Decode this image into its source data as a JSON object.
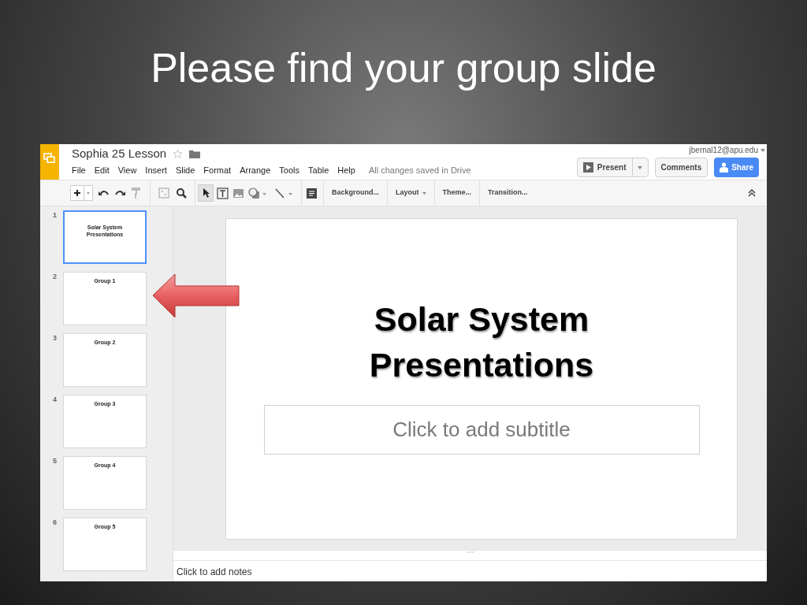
{
  "slide_title": "Please find your group slide",
  "app": {
    "doc_title": "Sophia 25 Lesson",
    "account": "jbernal12@apu.edu",
    "menus": [
      "File",
      "Edit",
      "View",
      "Insert",
      "Slide",
      "Format",
      "Arrange",
      "Tools",
      "Table",
      "Help"
    ],
    "save_status": "All changes saved in Drive",
    "present_button": "Present",
    "comments_button": "Comments",
    "share_button": "Share",
    "toolbar_buttons": [
      {
        "label": "Background...",
        "dropdown": false
      },
      {
        "label": "Layout",
        "dropdown": true
      },
      {
        "label": "Theme...",
        "dropdown": false
      },
      {
        "label": "Transition...",
        "dropdown": false
      }
    ],
    "filmstrip": [
      {
        "number": "1",
        "title_lines": [
          "Solar System",
          "Presentations"
        ],
        "selected": true
      },
      {
        "number": "2",
        "title_lines": [
          "Group 1"
        ],
        "selected": false
      },
      {
        "number": "3",
        "title_lines": [
          "Group 2"
        ],
        "selected": false
      },
      {
        "number": "4",
        "title_lines": [
          "Group 3"
        ],
        "selected": false
      },
      {
        "number": "5",
        "title_lines": [
          "Group 4"
        ],
        "selected": false
      },
      {
        "number": "6",
        "title_lines": [
          "Group 5"
        ],
        "selected": false
      }
    ],
    "current_slide": {
      "title_lines": [
        "Solar System",
        "Presentations"
      ],
      "subtitle_placeholder": "Click to add subtitle"
    },
    "notes_placeholder": "Click to add notes"
  }
}
